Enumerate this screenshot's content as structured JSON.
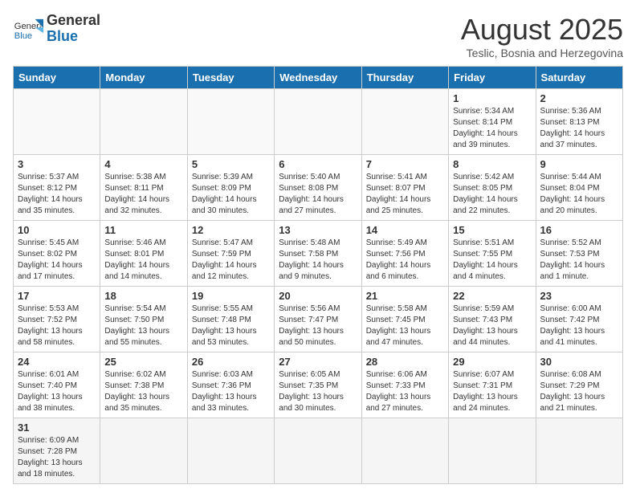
{
  "header": {
    "logo_general": "General",
    "logo_blue": "Blue",
    "month_title": "August 2025",
    "subtitle": "Teslic, Bosnia and Herzegovina"
  },
  "days_of_week": [
    "Sunday",
    "Monday",
    "Tuesday",
    "Wednesday",
    "Thursday",
    "Friday",
    "Saturday"
  ],
  "weeks": [
    [
      {
        "day": "",
        "info": ""
      },
      {
        "day": "",
        "info": ""
      },
      {
        "day": "",
        "info": ""
      },
      {
        "day": "",
        "info": ""
      },
      {
        "day": "",
        "info": ""
      },
      {
        "day": "1",
        "info": "Sunrise: 5:34 AM\nSunset: 8:14 PM\nDaylight: 14 hours\nand 39 minutes."
      },
      {
        "day": "2",
        "info": "Sunrise: 5:36 AM\nSunset: 8:13 PM\nDaylight: 14 hours\nand 37 minutes."
      }
    ],
    [
      {
        "day": "3",
        "info": "Sunrise: 5:37 AM\nSunset: 8:12 PM\nDaylight: 14 hours\nand 35 minutes."
      },
      {
        "day": "4",
        "info": "Sunrise: 5:38 AM\nSunset: 8:11 PM\nDaylight: 14 hours\nand 32 minutes."
      },
      {
        "day": "5",
        "info": "Sunrise: 5:39 AM\nSunset: 8:09 PM\nDaylight: 14 hours\nand 30 minutes."
      },
      {
        "day": "6",
        "info": "Sunrise: 5:40 AM\nSunset: 8:08 PM\nDaylight: 14 hours\nand 27 minutes."
      },
      {
        "day": "7",
        "info": "Sunrise: 5:41 AM\nSunset: 8:07 PM\nDaylight: 14 hours\nand 25 minutes."
      },
      {
        "day": "8",
        "info": "Sunrise: 5:42 AM\nSunset: 8:05 PM\nDaylight: 14 hours\nand 22 minutes."
      },
      {
        "day": "9",
        "info": "Sunrise: 5:44 AM\nSunset: 8:04 PM\nDaylight: 14 hours\nand 20 minutes."
      }
    ],
    [
      {
        "day": "10",
        "info": "Sunrise: 5:45 AM\nSunset: 8:02 PM\nDaylight: 14 hours\nand 17 minutes."
      },
      {
        "day": "11",
        "info": "Sunrise: 5:46 AM\nSunset: 8:01 PM\nDaylight: 14 hours\nand 14 minutes."
      },
      {
        "day": "12",
        "info": "Sunrise: 5:47 AM\nSunset: 7:59 PM\nDaylight: 14 hours\nand 12 minutes."
      },
      {
        "day": "13",
        "info": "Sunrise: 5:48 AM\nSunset: 7:58 PM\nDaylight: 14 hours\nand 9 minutes."
      },
      {
        "day": "14",
        "info": "Sunrise: 5:49 AM\nSunset: 7:56 PM\nDaylight: 14 hours\nand 6 minutes."
      },
      {
        "day": "15",
        "info": "Sunrise: 5:51 AM\nSunset: 7:55 PM\nDaylight: 14 hours\nand 4 minutes."
      },
      {
        "day": "16",
        "info": "Sunrise: 5:52 AM\nSunset: 7:53 PM\nDaylight: 14 hours\nand 1 minute."
      }
    ],
    [
      {
        "day": "17",
        "info": "Sunrise: 5:53 AM\nSunset: 7:52 PM\nDaylight: 13 hours\nand 58 minutes."
      },
      {
        "day": "18",
        "info": "Sunrise: 5:54 AM\nSunset: 7:50 PM\nDaylight: 13 hours\nand 55 minutes."
      },
      {
        "day": "19",
        "info": "Sunrise: 5:55 AM\nSunset: 7:48 PM\nDaylight: 13 hours\nand 53 minutes."
      },
      {
        "day": "20",
        "info": "Sunrise: 5:56 AM\nSunset: 7:47 PM\nDaylight: 13 hours\nand 50 minutes."
      },
      {
        "day": "21",
        "info": "Sunrise: 5:58 AM\nSunset: 7:45 PM\nDaylight: 13 hours\nand 47 minutes."
      },
      {
        "day": "22",
        "info": "Sunrise: 5:59 AM\nSunset: 7:43 PM\nDaylight: 13 hours\nand 44 minutes."
      },
      {
        "day": "23",
        "info": "Sunrise: 6:00 AM\nSunset: 7:42 PM\nDaylight: 13 hours\nand 41 minutes."
      }
    ],
    [
      {
        "day": "24",
        "info": "Sunrise: 6:01 AM\nSunset: 7:40 PM\nDaylight: 13 hours\nand 38 minutes."
      },
      {
        "day": "25",
        "info": "Sunrise: 6:02 AM\nSunset: 7:38 PM\nDaylight: 13 hours\nand 35 minutes."
      },
      {
        "day": "26",
        "info": "Sunrise: 6:03 AM\nSunset: 7:36 PM\nDaylight: 13 hours\nand 33 minutes."
      },
      {
        "day": "27",
        "info": "Sunrise: 6:05 AM\nSunset: 7:35 PM\nDaylight: 13 hours\nand 30 minutes."
      },
      {
        "day": "28",
        "info": "Sunrise: 6:06 AM\nSunset: 7:33 PM\nDaylight: 13 hours\nand 27 minutes."
      },
      {
        "day": "29",
        "info": "Sunrise: 6:07 AM\nSunset: 7:31 PM\nDaylight: 13 hours\nand 24 minutes."
      },
      {
        "day": "30",
        "info": "Sunrise: 6:08 AM\nSunset: 7:29 PM\nDaylight: 13 hours\nand 21 minutes."
      }
    ],
    [
      {
        "day": "31",
        "info": "Sunrise: 6:09 AM\nSunset: 7:28 PM\nDaylight: 13 hours\nand 18 minutes."
      },
      {
        "day": "",
        "info": ""
      },
      {
        "day": "",
        "info": ""
      },
      {
        "day": "",
        "info": ""
      },
      {
        "day": "",
        "info": ""
      },
      {
        "day": "",
        "info": ""
      },
      {
        "day": "",
        "info": ""
      }
    ]
  ]
}
